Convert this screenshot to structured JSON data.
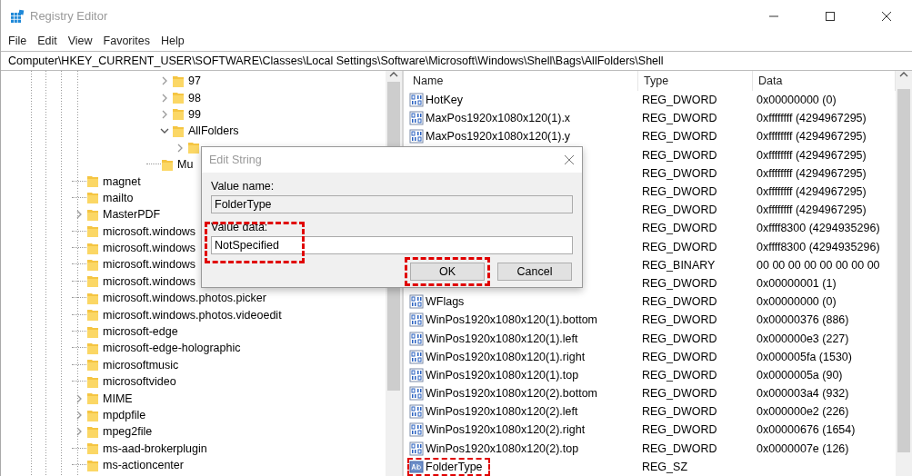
{
  "window": {
    "title": "Registry Editor"
  },
  "menu": [
    "File",
    "Edit",
    "View",
    "Favorites",
    "Help"
  ],
  "address": "Computer\\HKEY_CURRENT_USER\\SOFTWARE\\Classes\\Local Settings\\Software\\Microsoft\\Windows\\Shell\\Bags\\AllFolders\\Shell",
  "tree": [
    {
      "children": [
        {
          "children": [
            {
              "name": "97",
              "expandable": true,
              "expanded": false
            },
            {
              "name": "98",
              "expandable": true,
              "expanded": false
            },
            {
              "name": "99",
              "expandable": true,
              "expanded": false
            },
            {
              "name": "AllFolders",
              "expandable": true,
              "expanded": true,
              "children": [
                {
                  "expandable": true,
                  "expanded": false
                }
              ]
            }
          ]
        },
        {
          "name": "Mu",
          "expandable": false
        }
      ]
    },
    {
      "name": "magnet",
      "expandable": false
    },
    {
      "name": "mailto",
      "expandable": false
    },
    {
      "name": "MasterPDF",
      "expandable": true,
      "expanded": false
    },
    {
      "name": "microsoft.windows",
      "expandable": false
    },
    {
      "name": "microsoft.windows",
      "expandable": false
    },
    {
      "name": "microsoft.windows",
      "expandable": false
    },
    {
      "name": "microsoft.windows",
      "expandable": false
    },
    {
      "name": "microsoft.windows.photos.picker",
      "expandable": false
    },
    {
      "name": "microsoft.windows.photos.videoedit",
      "expandable": false
    },
    {
      "name": "microsoft-edge",
      "expandable": false
    },
    {
      "name": "microsoft-edge-holographic",
      "expandable": false
    },
    {
      "name": "microsoftmusic",
      "expandable": false
    },
    {
      "name": "microsoftvideo",
      "expandable": false
    },
    {
      "name": "MIME",
      "expandable": true,
      "expanded": false
    },
    {
      "name": "mpdpfile",
      "expandable": true,
      "expanded": false
    },
    {
      "name": "mpeg2file",
      "expandable": true,
      "expanded": false
    },
    {
      "name": "ms-aad-brokerplugin",
      "expandable": false
    },
    {
      "name": "ms-actioncenter",
      "expandable": false
    }
  ],
  "table": {
    "columns": [
      "Name",
      "Type",
      "Data"
    ],
    "rows": [
      {
        "kind": "dword",
        "name": "HotKey",
        "type": "REG_DWORD",
        "data": "0x00000000 (0)",
        "highlighted": false
      },
      {
        "kind": "dword",
        "name": "MaxPos1920x1080x120(1).x",
        "type": "REG_DWORD",
        "data": "0xffffffff (4294967295)",
        "highlighted": false
      },
      {
        "kind": "dword",
        "name": "MaxPos1920x1080x120(1).y",
        "type": "REG_DWORD",
        "data": "0xffffffff (4294967295)",
        "highlighted": false
      },
      {
        "type": "REG_DWORD",
        "data": "0xffffffff (4294967295)"
      },
      {
        "type": "REG_DWORD",
        "data": "0xffffffff (4294967295)"
      },
      {
        "type": "REG_DWORD",
        "data": "0xffffffff (4294967295)"
      },
      {
        "type": "REG_DWORD",
        "data": "0xffffffff (4294967295)"
      },
      {
        "type": "REG_DWORD",
        "data": "0xffff8300 (4294935296)"
      },
      {
        "type": "REG_DWORD",
        "data": "0xffff8300 (4294935296)"
      },
      {
        "type": "REG_BINARY",
        "data": "00 00 00 00 00 00 00 00"
      },
      {
        "type": "REG_DWORD",
        "data": "0x00000001 (1)"
      },
      {
        "kind": "dword",
        "name": "WFlags",
        "type": "REG_DWORD",
        "data": "0x00000000 (0)",
        "highlighted": false
      },
      {
        "kind": "dword",
        "name": "WinPos1920x1080x120(1).bottom",
        "type": "REG_DWORD",
        "data": "0x00000376 (886)",
        "highlighted": false
      },
      {
        "kind": "dword",
        "name": "WinPos1920x1080x120(1).left",
        "type": "REG_DWORD",
        "data": "0x000000e3 (227)",
        "highlighted": false
      },
      {
        "kind": "dword",
        "name": "WinPos1920x1080x120(1).right",
        "type": "REG_DWORD",
        "data": "0x000005fa (1530)",
        "highlighted": false
      },
      {
        "kind": "dword",
        "name": "WinPos1920x1080x120(1).top",
        "type": "REG_DWORD",
        "data": "0x0000005a (90)",
        "highlighted": false
      },
      {
        "kind": "dword",
        "name": "WinPos1920x1080x120(2).bottom",
        "type": "REG_DWORD",
        "data": "0x000003a4 (932)",
        "highlighted": false
      },
      {
        "kind": "dword",
        "name": "WinPos1920x1080x120(2).left",
        "type": "REG_DWORD",
        "data": "0x000000e2 (226)",
        "highlighted": false
      },
      {
        "kind": "dword",
        "name": "WinPos1920x1080x120(2).right",
        "type": "REG_DWORD",
        "data": "0x00000676 (1654)",
        "highlighted": false
      },
      {
        "kind": "dword",
        "name": "WinPos1920x1080x120(2).top",
        "type": "REG_DWORD",
        "data": "0x0000007e (126)",
        "highlighted": false
      },
      {
        "kind": "string",
        "name": "FolderType",
        "type": "REG_SZ",
        "highlighted": true
      }
    ]
  },
  "dialog": {
    "title": "Edit String",
    "name_label": "Value name:",
    "name_value": "FolderType",
    "data_label": "Value data:",
    "data_value": "NotSpecified",
    "data_highlighted": true,
    "buttons": [
      {
        "label": "OK",
        "highlighted": true
      },
      {
        "label": "Cancel",
        "highlighted": false
      }
    ]
  }
}
